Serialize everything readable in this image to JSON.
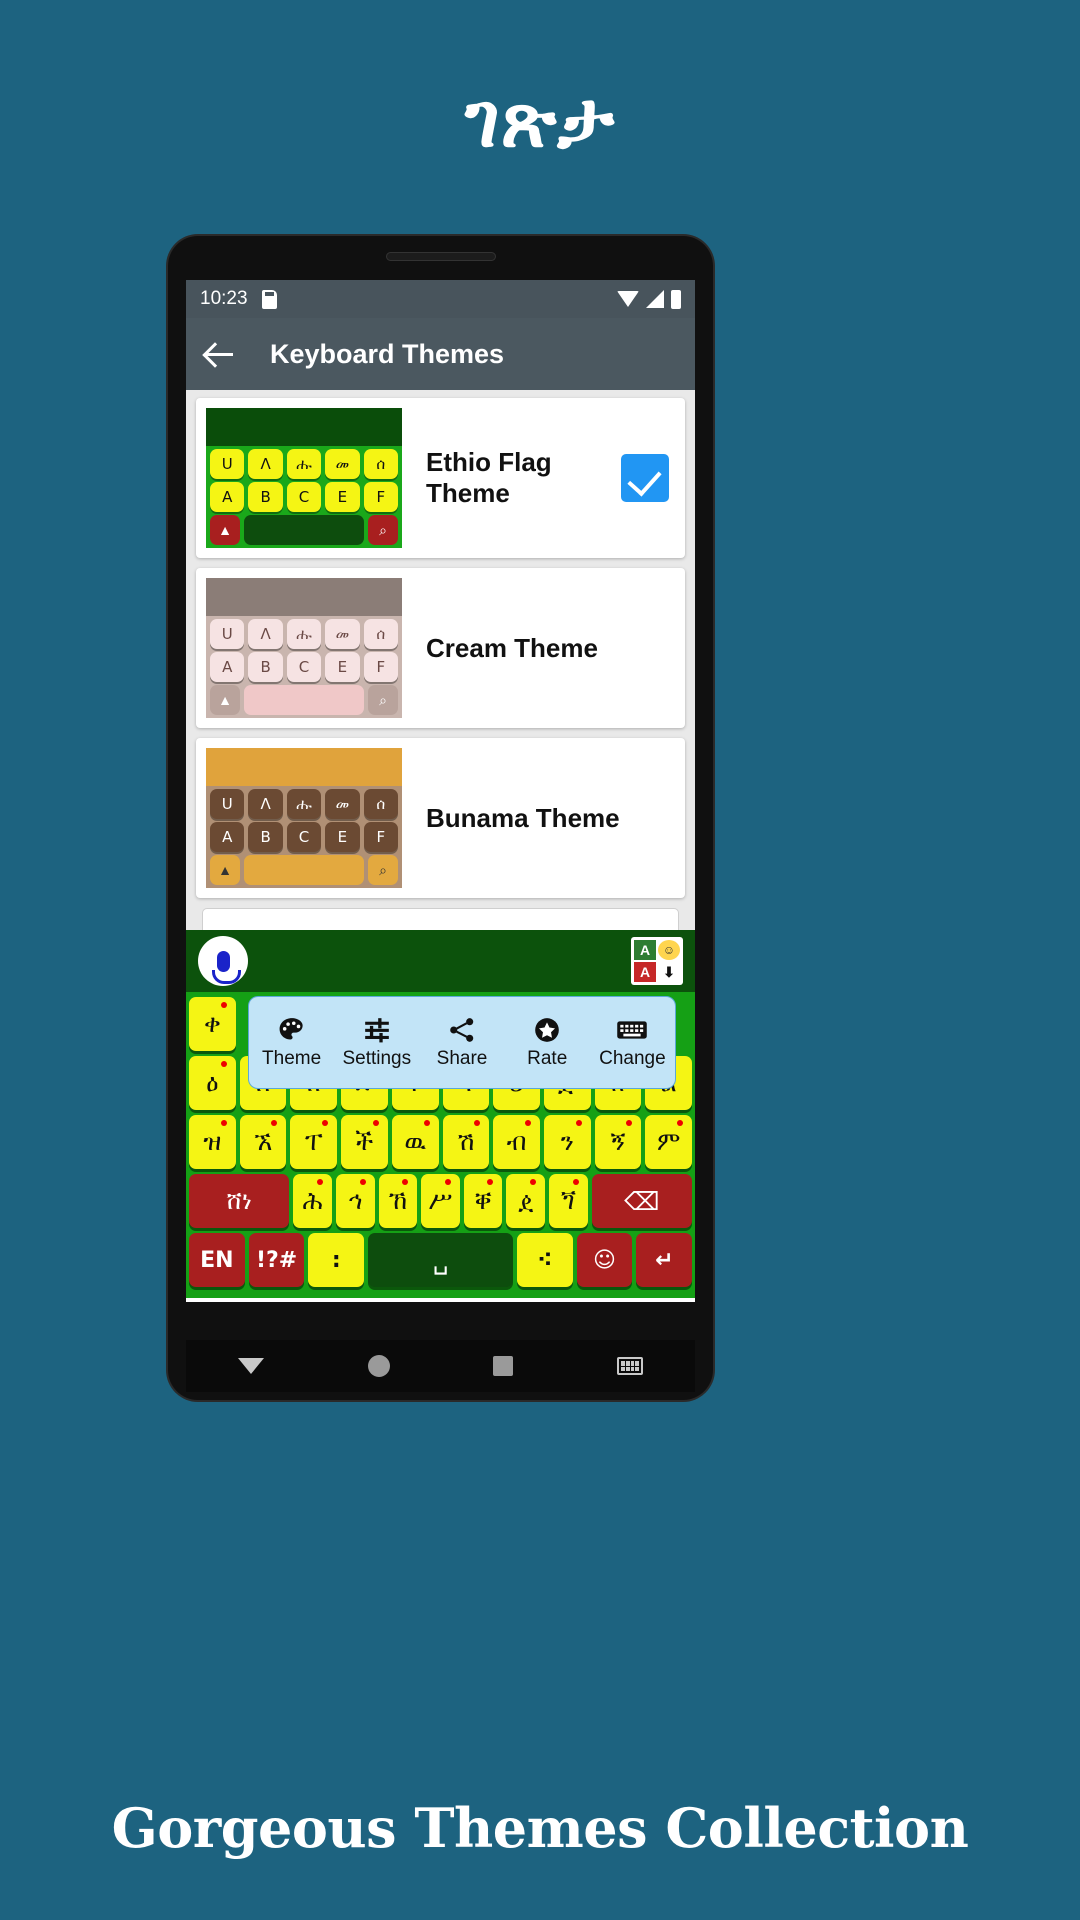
{
  "headline": "ገጽታ",
  "caption": "Gorgeous Themes Collection",
  "colors": {
    "page_background": "#1d6380",
    "appbar": "#4b5860",
    "accent_check": "#2196f3",
    "keyboard_key": "#f5f514",
    "keyboard_bg": "#15a015",
    "keyboard_dark": "#0d5c0d",
    "key_red": "#a81f1f",
    "popup_bg": "#c2e4f7"
  },
  "status_bar": {
    "time": "10:23",
    "icons": [
      "sd-card-icon",
      "wifi-icon",
      "signal-icon",
      "battery-icon"
    ]
  },
  "app_bar": {
    "back_icon": "back-arrow-icon",
    "title": "Keyboard Themes"
  },
  "themes": [
    {
      "name": "Ethio Flag Theme",
      "selected": true,
      "preview": {
        "top_bar": "#0a4d0a",
        "body": "#1aa81a",
        "key_bg": "#f5f514",
        "key_text": "#111111",
        "accent_key": "#a81f1f",
        "space_key": "#0d4d0d",
        "row1": [
          "U",
          "Λ",
          "ሑ",
          "መ",
          "ሰ"
        ],
        "row2": [
          "A",
          "B",
          "C",
          "E",
          "F"
        ]
      }
    },
    {
      "name": "Cream Theme",
      "selected": false,
      "preview": {
        "top_bar": "#8b7d77",
        "body": "#c9b5ae",
        "key_bg": "#f6e3e3",
        "key_text": "#6b4a46",
        "accent_key": "#b9a39c",
        "space_key": "#f0c8c8",
        "row1": [
          "U",
          "Λ",
          "ሑ",
          "መ",
          "ሰ"
        ],
        "row2": [
          "A",
          "B",
          "C",
          "E",
          "F"
        ]
      }
    },
    {
      "name": "Bunama Theme",
      "selected": false,
      "preview": {
        "top_bar": "#e0a33c",
        "body": "#b09075",
        "key_bg": "#6b4a33",
        "key_text": "#ffffff",
        "accent_key": "#e3a93f",
        "space_key": "#e3a93f",
        "row1": [
          "U",
          "Λ",
          "ሑ",
          "መ",
          "ሰ"
        ],
        "row2": [
          "A",
          "B",
          "C",
          "E",
          "F"
        ]
      }
    }
  ],
  "keyboard": {
    "suggestion_bar": {
      "mic_icon": "microphone-icon",
      "language_button_icon": "language-switch-icon",
      "language_cells": [
        "A",
        "☺",
        "A",
        "⬇"
      ]
    },
    "popup_menu": [
      {
        "label": "Theme",
        "icon": "palette-icon"
      },
      {
        "label": "Settings",
        "icon": "sliders-icon"
      },
      {
        "label": "Share",
        "icon": "share-icon"
      },
      {
        "label": "Rate",
        "icon": "star-icon"
      },
      {
        "label": "Change",
        "icon": "keyboard-icon"
      }
    ],
    "rows": [
      [
        "ቀ",
        "",
        "",
        "",
        "",
        "",
        "",
        "",
        "",
        ""
      ],
      [
        "ዕ",
        "ስ",
        "ሸ",
        "ድ",
        "ፍ",
        "ግ",
        "ህ",
        "ጅ",
        "ክ",
        "ል"
      ],
      [
        "ዝ",
        "ኧ",
        "ፐ",
        "ች",
        "ዉ",
        "ሽ",
        "ብ",
        "ን",
        "ኝ",
        "ም"
      ],
      [
        "ሸነ",
        "ሕ",
        "ኅ",
        "ኸ",
        "ሥ",
        "ቐ",
        "ዸ",
        "ጘ",
        "⌫"
      ],
      [
        "EN",
        "!?#",
        ":",
        "␣",
        "⁖",
        "☺",
        "↵"
      ]
    ],
    "row4_first_key": "ሸነ",
    "row4_last_key": "backspace-icon",
    "row5": [
      {
        "label": "EN",
        "type": "red"
      },
      {
        "label": "!?#",
        "type": "red"
      },
      {
        "label": ":",
        "type": "yellow"
      },
      {
        "label": "␣",
        "type": "dark"
      },
      {
        "label": "⁖",
        "type": "yellow"
      },
      {
        "label": "☺",
        "type": "red"
      },
      {
        "label": "↵",
        "type": "red"
      }
    ]
  },
  "nav_bar": {
    "items": [
      "back-triangle-icon",
      "home-circle-icon",
      "recents-square-icon",
      "keyboard-icon"
    ]
  }
}
